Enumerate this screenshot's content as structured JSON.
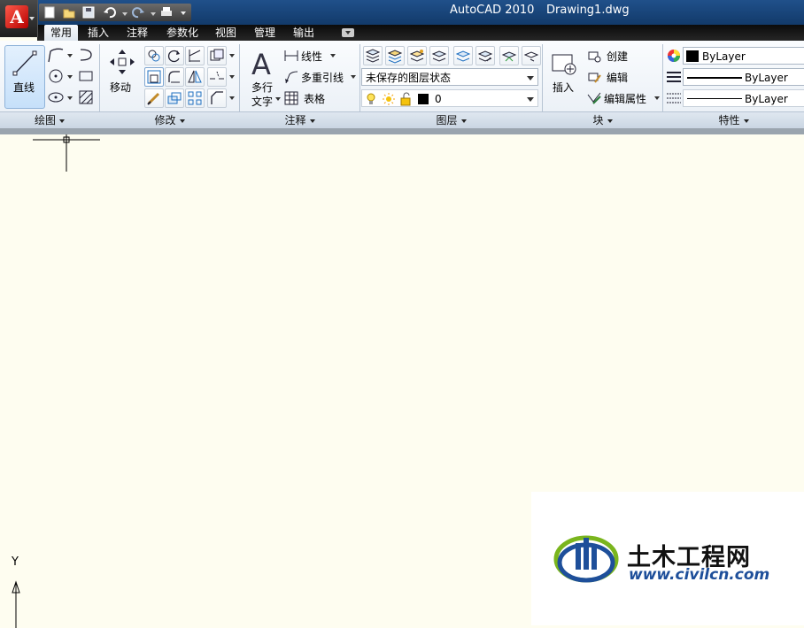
{
  "window": {
    "app_title": "AutoCAD 2010",
    "doc_title": "Drawing1.dwg"
  },
  "app_button": {
    "logo": "A"
  },
  "qat": {
    "icons": [
      "new-icon",
      "open-icon",
      "save-icon",
      "undo-icon",
      "redo-icon",
      "plot-icon"
    ]
  },
  "tabs": [
    "常用",
    "插入",
    "注释",
    "参数化",
    "视图",
    "管理",
    "输出"
  ],
  "panels": {
    "draw": {
      "title": "绘图",
      "line_label": "直线"
    },
    "modify": {
      "title": "修改",
      "move_label": "移动"
    },
    "annotation": {
      "title": "注释",
      "mtext_label_1": "多行",
      "mtext_label_2": "文字",
      "dim_label": "线性",
      "mleader_label": "多重引线",
      "table_label": "表格"
    },
    "layers": {
      "title": "图层",
      "layer_state": "未保存的图层状态",
      "current_layer": "0"
    },
    "block": {
      "title": "块",
      "insert_label": "插入",
      "create_label": "创建",
      "edit_label": "编辑",
      "edit_attr_label": "编辑属性"
    },
    "properties": {
      "title": "特性",
      "color": "ByLayer",
      "linetype": "ByLayer",
      "lineweight": "ByLayer"
    }
  },
  "ucs": {
    "y_label": "Y"
  },
  "watermark": {
    "brand": "土木工程网",
    "url": "www.civilcn.com"
  },
  "colors": {
    "canvas_bg": "#fefdf0",
    "title_bar": "#1a4a80",
    "watermark_green": "#7ab51d",
    "watermark_blue": "#1e4f9a"
  }
}
